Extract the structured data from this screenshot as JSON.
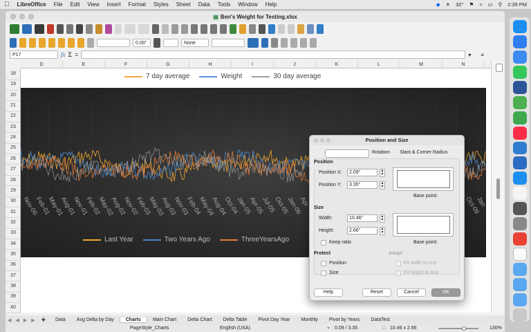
{
  "menubar": {
    "app": "LibreOffice",
    "items": [
      "File",
      "Edit",
      "View",
      "Insert",
      "Format",
      "Styles",
      "Sheet",
      "Data",
      "Tools",
      "Window",
      "Help"
    ],
    "temp": "32°",
    "clock": "2:39 PM"
  },
  "window": {
    "title": "Ben's Weight for Testing.xlsx"
  },
  "toolbar2": {
    "size_value": "0.00\"",
    "line_style": "None"
  },
  "formulabar": {
    "cell_ref": "P17"
  },
  "columns": [
    "D",
    "E",
    "F",
    "G",
    "H",
    "I",
    "J",
    "K",
    "L",
    "M",
    "N"
  ],
  "rows": [
    "18",
    "19",
    "20",
    "21",
    "22",
    "23",
    "24",
    "25",
    "26",
    "27",
    "28",
    "29",
    "30",
    "31",
    "32",
    "33",
    "34",
    "35",
    "36",
    "37",
    "38",
    "39",
    "40"
  ],
  "chart_top_legend": [
    "7 day average",
    "Weight",
    "30 day average"
  ],
  "chart_top_colors": [
    "#f4a742",
    "#5b8fd6",
    "#9e9e9e"
  ],
  "chart_bottom_legend": [
    "Last Year",
    "Two Years Ago",
    "ThreeYearsAgo"
  ],
  "chart_bottom_colors": [
    "#f0a830",
    "#4f86c6",
    "#e07b39"
  ],
  "chart_data": {
    "type": "line",
    "series": [
      {
        "name": "7 day average"
      },
      {
        "name": "Weight"
      },
      {
        "name": "30 day average"
      },
      {
        "name": "Last Year"
      },
      {
        "name": "Two Years Ago"
      },
      {
        "name": "ThreeYearsAgo"
      }
    ],
    "x_tick_labels": [
      "Nov-00",
      "Feb-01",
      "May-01",
      "Aug-01",
      "Nov-01",
      "Feb-02",
      "May-02",
      "Aug-02",
      "Nov-02",
      "Feb-03",
      "May-03",
      "Aug-03",
      "Nov-03",
      "Feb-04",
      "May-04",
      "Aug-04",
      "Oct-04",
      "Jan-05",
      "Apr-05",
      "Jul-05",
      "Oct-05",
      "Jan-06",
      "Apr"
    ],
    "x_tick_labels_right": [
      "Jun",
      "Oct-09",
      "Jan"
    ]
  },
  "dialog": {
    "title": "Position and Size",
    "tabs": [
      "",
      "Rotation",
      "Slant & Corner Radius"
    ],
    "position_section": "Position",
    "pos_x_label": "Position X:",
    "pos_x_value": "2.09\"",
    "pos_y_label": "Position Y:",
    "pos_y_value": "3.35\"",
    "base_point_label": "Base point:",
    "size_section": "Size",
    "width_label": "Width:",
    "width_value": "10.46\"",
    "height_label": "Height:",
    "height_value": "2.66\"",
    "keep_ratio": "Keep ratio",
    "protect_section": "Protect",
    "protect_position": "Position",
    "protect_size": "Size",
    "adapt_section": "Adapt",
    "fit_width": "Fit width to text",
    "fit_height": "Fit height to text",
    "help": "Help",
    "reset": "Reset",
    "cancel": "Cancel",
    "ok": "OK"
  },
  "sheet_tabs": [
    "Data",
    "Avg Delta by Day",
    "Charts",
    "Main Chart",
    "Delta Chart",
    "Delta Table",
    "Pivot Day Year",
    "Monthly",
    "Pivot by Years",
    "DataTest"
  ],
  "active_tab": "Charts",
  "status": {
    "page_style": "PageStyle_Charts",
    "language": "English (USA)",
    "position": "0.09 / 3.35",
    "size": "10.46 x 2.66",
    "zoom": "130%"
  }
}
